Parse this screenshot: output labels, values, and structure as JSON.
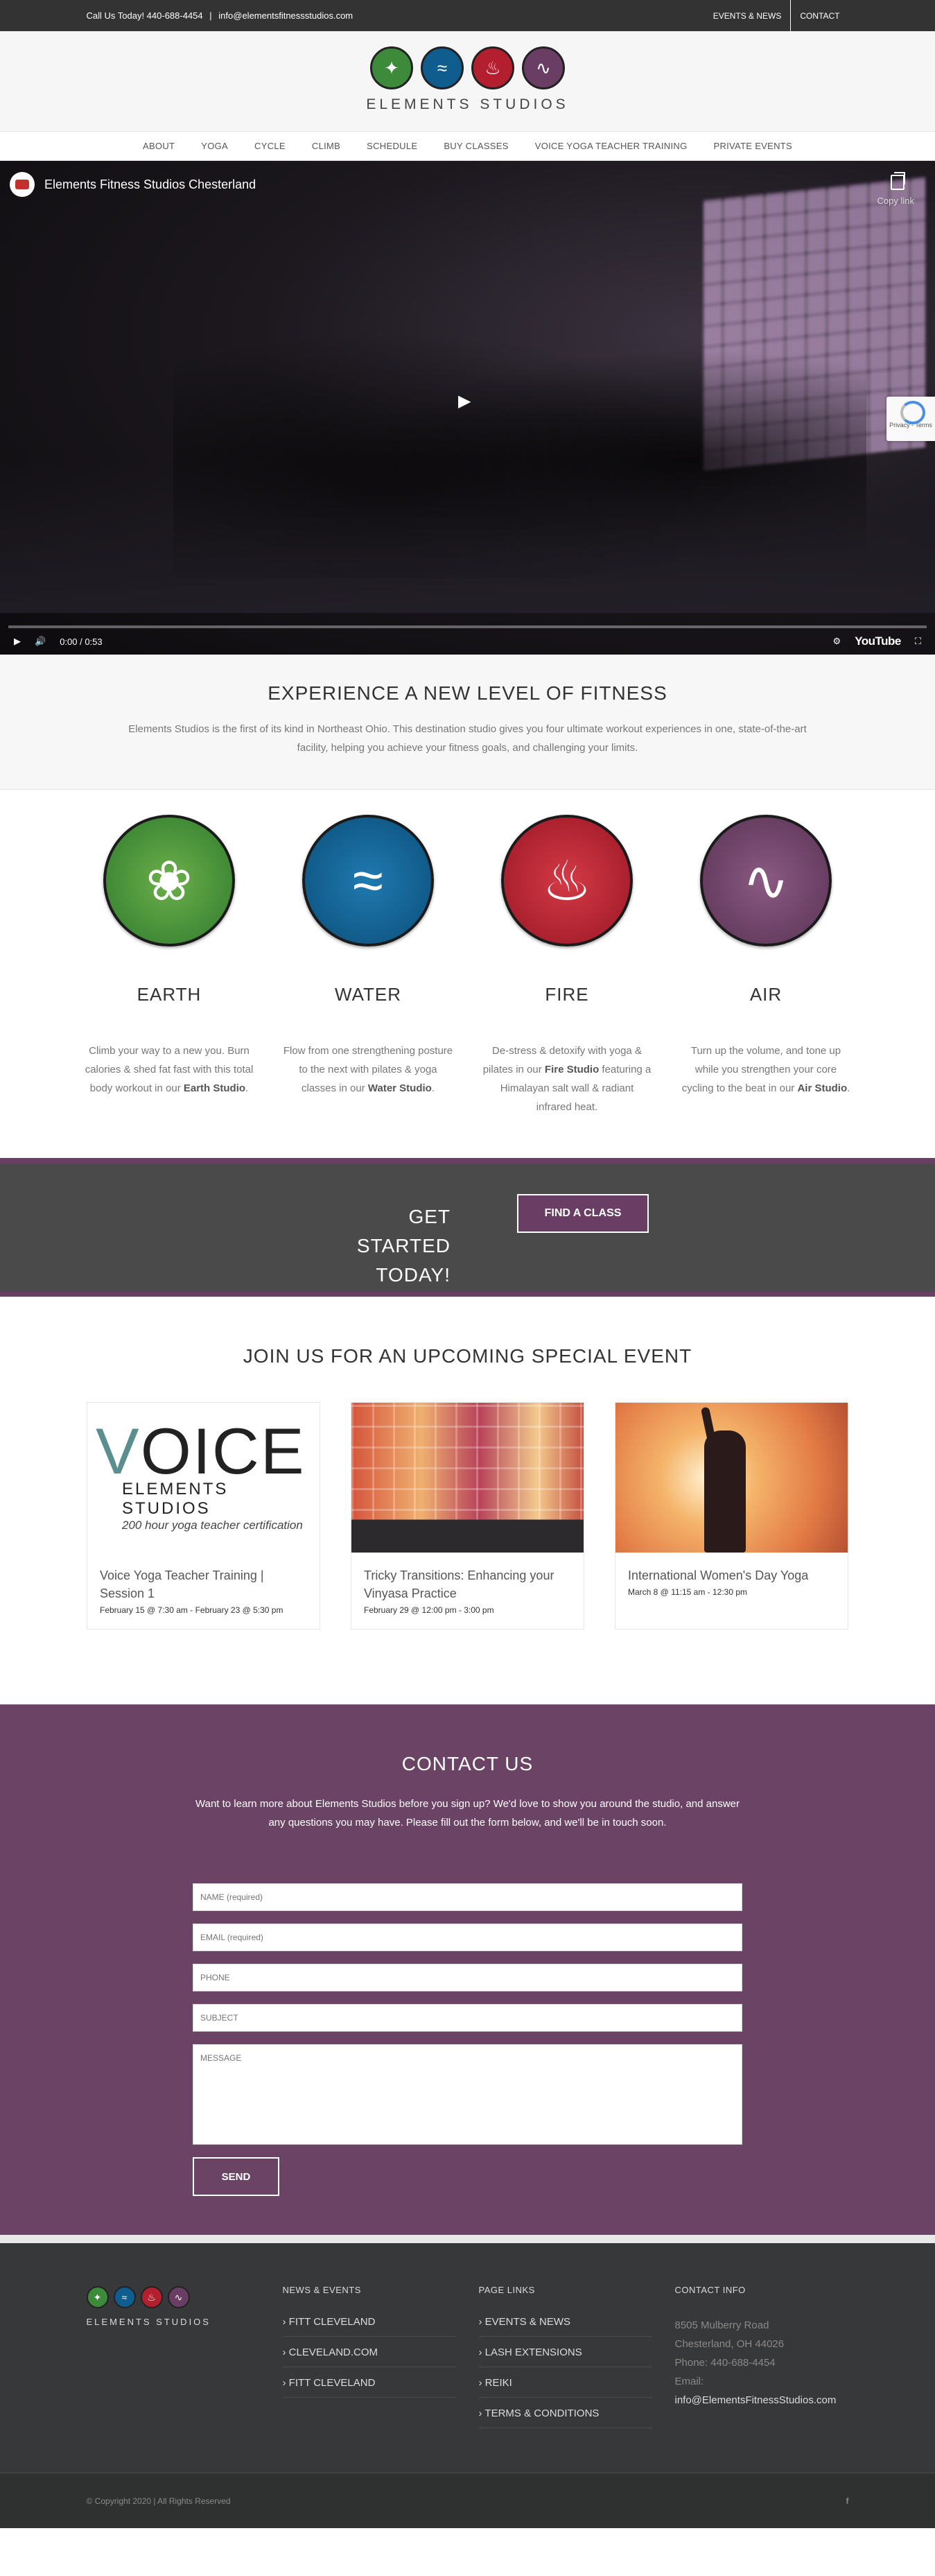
{
  "topbar": {
    "phone_text": "Call Us Today! 440-688-4454",
    "separator": "|",
    "email_text": "info@elementsfitnessstudios.com",
    "links": [
      "EVENTS & NEWS",
      "CONTACT"
    ]
  },
  "brand": {
    "name": "ELEMENTS STUDIOS",
    "colors": {
      "earth": "#3c8a3a",
      "water": "#0f5d8f",
      "fire": "#b31f2e",
      "air": "#6a3d64",
      "accent": "#6a4365"
    }
  },
  "nav": [
    "ABOUT",
    "YOGA",
    "CYCLE",
    "CLIMB",
    "SCHEDULE",
    "BUY CLASSES",
    "VOICE YOGA TEACHER TRAINING",
    "PRIVATE EVENTS"
  ],
  "video": {
    "title": "Elements Fitness Studios Chesterland",
    "copy_label": "Copy link",
    "time": "0:00 / 0:53",
    "brand": "YouTube",
    "recaptcha": "Privacy - Terms",
    "progress": 0
  },
  "intro": {
    "heading": "EXPERIENCE A NEW LEVEL OF FITNESS",
    "text": "Elements Studios is the first of its kind in Northeast Ohio. This destination studio gives you four ultimate workout experiences in one, state-of-the-art facility, helping you achieve your fitness goals, and challenging your limits."
  },
  "elements": [
    {
      "name": "EARTH",
      "icon": "leaf-flame-icon",
      "text_a": "Climb your way to a new you. Burn calories & shed fat fast with this total body workout in our ",
      "studio": "Earth Studio",
      "text_b": "."
    },
    {
      "name": "WATER",
      "icon": "wave-icon",
      "text_a": "Flow from one strengthening posture to the next with pilates & yoga classes in our ",
      "studio": "Water Studio",
      "text_b": "."
    },
    {
      "name": "FIRE",
      "icon": "flame-icon",
      "text_a": "De-stress & detoxify with yoga & pilates in our ",
      "studio": "Fire Studio",
      "text_b": " featuring a Himalayan salt wall & radiant infrared heat."
    },
    {
      "name": "AIR",
      "icon": "swirl-icon",
      "text_a": "Turn up the volume, and tone up while you strengthen your core cycling to the beat in our ",
      "studio": "Air Studio",
      "text_b": "."
    }
  ],
  "started": {
    "heading_line1": "GET STARTED",
    "heading_line2": "TODAY!",
    "button": "FIND A CLASS"
  },
  "events": {
    "heading": "JOIN US FOR AN UPCOMING SPECIAL EVENT",
    "items": [
      {
        "title": "Voice Yoga Teacher Training | Session 1",
        "date": "February 15 @ 7:30 am - February 23 @ 5:30 pm",
        "img_text": "OICE",
        "img_sub1": "ELEMENTS STUDIOS",
        "img_sub2": "200 hour yoga teacher certification"
      },
      {
        "title": "Tricky Transitions: Enhancing your Vinyasa Practice",
        "date": "February 29 @ 12:00 pm - 3:00 pm"
      },
      {
        "title": "International Women's Day Yoga",
        "date": "March 8 @ 11:15 am - 12:30 pm"
      }
    ]
  },
  "contact": {
    "heading": "CONTACT US",
    "text": "Want to learn more about Elements Studios before you sign up? We'd love to show you around the studio, and answer any questions you may have. Please fill out the form below, and we'll be in touch soon.",
    "placeholders": {
      "name": "NAME (required)",
      "email": "EMAIL (required)",
      "phone": "PHONE",
      "subject": "SUBJECT",
      "message": "MESSAGE"
    },
    "send": "SEND"
  },
  "footer": {
    "logo_text": "ELEMENTS STUDIOS",
    "news_heading": "NEWS & EVENTS",
    "news_links": [
      "FITT CLEVELAND",
      "CLEVELAND.COM",
      "FITT CLEVELAND"
    ],
    "page_heading": "PAGE LINKS",
    "page_links": [
      "EVENTS & NEWS",
      "LASH EXTENSIONS",
      "REIKI",
      "TERMS & CONDITIONS"
    ],
    "contact_heading": "CONTACT INFO",
    "address1": "8505 Mulberry Road",
    "address2": "Chesterland, OH 44026",
    "phone": "Phone: 440-688-4454",
    "email_label": "Email:",
    "email": "info@ElementsFitnessStudios.com",
    "copyright": "© Copyright 2020 | All Rights Reserved",
    "social_icon": "facebook-icon"
  }
}
